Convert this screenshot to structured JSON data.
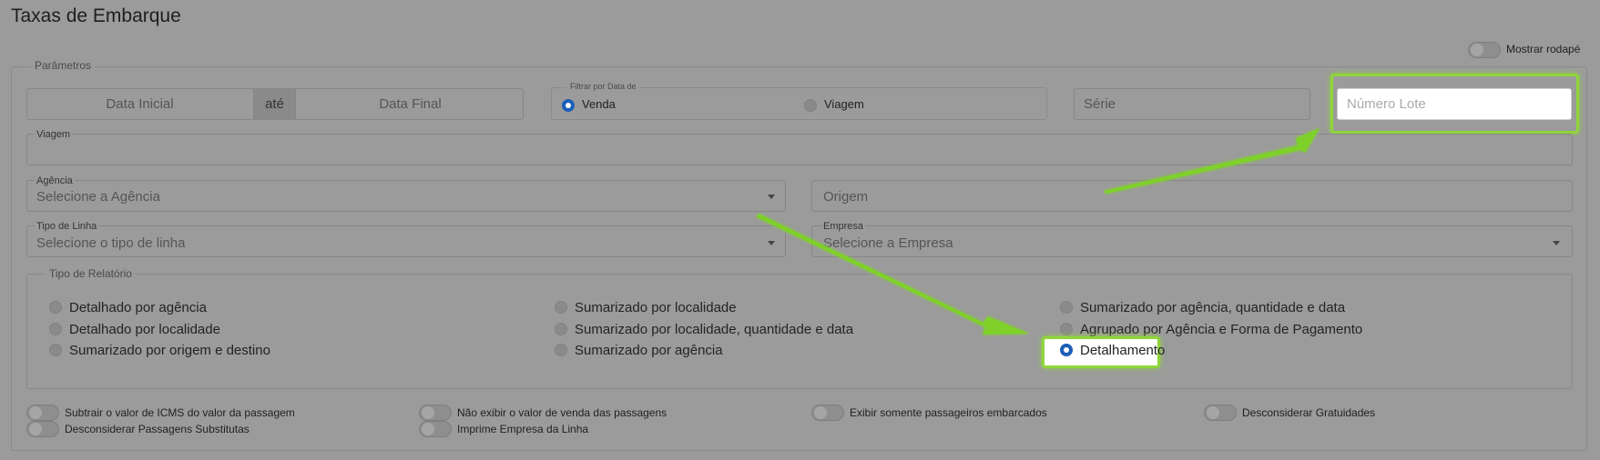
{
  "page": {
    "title": "Taxas de Embarque"
  },
  "footer_toggle": {
    "label": "Mostrar rodapé"
  },
  "parametros": {
    "legend": "Parâmetros",
    "data_inicial": "Data Inicial",
    "ate": "até",
    "data_final": "Data Final",
    "filtro_data": {
      "legend": "Filtrar por Data de",
      "venda": "Venda",
      "viagem": "Viagem"
    },
    "serie_placeholder": "Série",
    "numero_lote_placeholder": "Número Lote",
    "viagem_label": "Viagem",
    "agencia": {
      "label": "Agência",
      "placeholder": "Selecione a Agência"
    },
    "origem_placeholder": "Origem",
    "tipo_linha": {
      "label": "Tipo de Linha",
      "placeholder": "Selecione o tipo de linha"
    },
    "empresa": {
      "label": "Empresa",
      "placeholder": "Selecione a Empresa"
    }
  },
  "tipo_relatorio": {
    "legend": "Tipo de Relatório",
    "options": [
      "Detalhado por agência",
      "Detalhado por localidade",
      "Sumarizado por origem e destino",
      "Sumarizado por localidade",
      "Sumarizado por localidade, quantidade e data",
      "Sumarizado por agência",
      "Sumarizado por agência, quantidade e data",
      "Agrupado por Agência e Forma de Pagamento",
      "Detalhamento"
    ],
    "selected": "Detalhamento"
  },
  "toggles": [
    "Subtrair o valor de ICMS do valor da passagem",
    "Desconsiderar Passagens Substitutas",
    "Não exibir o valor de venda das passagens",
    "Imprime Empresa da Linha",
    "Exibir somente passageiros embarcados",
    "Desconsiderar Gratuidades"
  ],
  "colors": {
    "highlight": "#8fd63a",
    "arrow": "#7fd12a",
    "radio_selected": "#1d5fb8"
  }
}
